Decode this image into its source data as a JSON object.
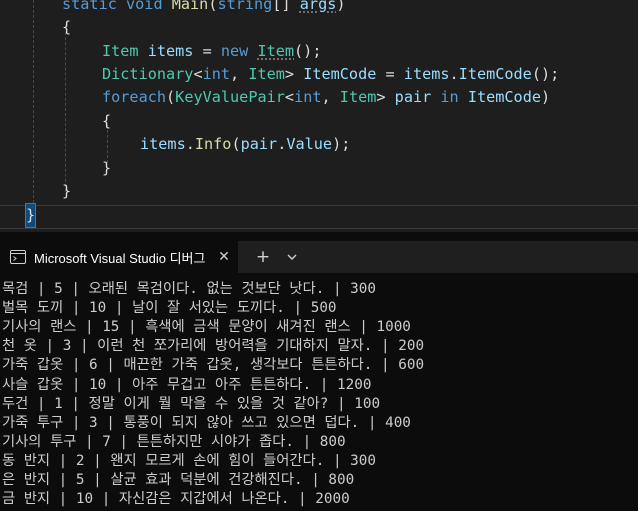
{
  "editor": {
    "lines": [
      {
        "parts": [
          {
            "c": "k",
            "t": "static "
          },
          {
            "c": "k",
            "t": "void "
          },
          {
            "c": "m",
            "t": "Main"
          },
          {
            "c": "p",
            "t": "("
          },
          {
            "c": "k",
            "t": "string"
          },
          {
            "c": "p",
            "t": "[] "
          },
          {
            "c": "v",
            "t": "args"
          },
          {
            "c": "p",
            "t": ")"
          }
        ]
      },
      {
        "parts": [
          {
            "c": "p",
            "t": "{"
          }
        ]
      },
      {
        "parts": [
          {
            "c": "t",
            "t": "Item "
          },
          {
            "c": "v",
            "t": "items"
          },
          {
            "c": "p",
            "t": " = "
          },
          {
            "c": "k",
            "t": "new "
          },
          {
            "c": "t",
            "t": "Item"
          },
          {
            "c": "p",
            "t": "();"
          }
        ]
      },
      {
        "parts": [
          {
            "c": "t",
            "t": "Dictionary"
          },
          {
            "c": "p",
            "t": "<"
          },
          {
            "c": "k",
            "t": "int"
          },
          {
            "c": "p",
            "t": ", "
          },
          {
            "c": "t",
            "t": "Item"
          },
          {
            "c": "p",
            "t": "> "
          },
          {
            "c": "v",
            "t": "ItemCode"
          },
          {
            "c": "p",
            "t": " = "
          },
          {
            "c": "v",
            "t": "items"
          },
          {
            "c": "p",
            "t": "."
          },
          {
            "c": "v",
            "t": "ItemCode"
          },
          {
            "c": "p",
            "t": "();"
          }
        ]
      },
      {
        "parts": [
          {
            "c": "k",
            "t": "foreach"
          },
          {
            "c": "p",
            "t": "("
          },
          {
            "c": "t",
            "t": "KeyValuePair"
          },
          {
            "c": "p",
            "t": "<"
          },
          {
            "c": "k",
            "t": "int"
          },
          {
            "c": "p",
            "t": ", "
          },
          {
            "c": "t",
            "t": "Item"
          },
          {
            "c": "p",
            "t": "> "
          },
          {
            "c": "v",
            "t": "pair"
          },
          {
            "c": "k",
            "t": " in "
          },
          {
            "c": "v",
            "t": "ItemCode"
          },
          {
            "c": "p",
            "t": ")"
          }
        ]
      },
      {
        "parts": [
          {
            "c": "p",
            "t": "{"
          }
        ]
      },
      {
        "parts": [
          {
            "c": "v",
            "t": "items"
          },
          {
            "c": "p",
            "t": "."
          },
          {
            "c": "m",
            "t": "Info"
          },
          {
            "c": "p",
            "t": "("
          },
          {
            "c": "v",
            "t": "pair"
          },
          {
            "c": "p",
            "t": "."
          },
          {
            "c": "v",
            "t": "Value"
          },
          {
            "c": "p",
            "t": ");"
          }
        ]
      },
      {
        "parts": [
          {
            "c": "p",
            "t": "}"
          }
        ]
      },
      {
        "parts": [
          {
            "c": "p",
            "t": "}"
          }
        ]
      },
      {
        "parts": [
          {
            "c": "p",
            "t": "}"
          }
        ]
      }
    ]
  },
  "terminal": {
    "tab_title": "Microsoft Visual Studio 디버그",
    "close_glyph": "✕",
    "add_glyph": "+",
    "output": [
      "목검 | 5 | 오래된 목검이다. 없는 것보단 낫다. | 300",
      "벌목 도끼 | 10 | 날이 잘 서있는 도끼다. | 500",
      "기사의 랜스 | 15 | 흑색에 금색 문양이 새겨진 랜스 | 1000",
      "천 옷 | 3 | 이런 천 쪼가리에 방어력을 기대하지 말자. | 200",
      "가죽 갑옷 | 6 | 매끈한 가죽 갑옷, 생각보다 튼튼하다. | 600",
      "사슬 갑옷 | 10 | 아주 무겁고 아주 튼튼하다. | 1200",
      "두건 | 1 | 정말 이게 뭘 막을 수 있을 것 같아? | 100",
      "가죽 투구 | 3 | 통풍이 되지 않아 쓰고 있으면 덥다. | 400",
      "기사의 투구 | 7 | 튼튼하지만 시야가 좁다. | 800",
      "동 반지 | 2 | 왠지 모르게 손에 힘이 들어간다. | 300",
      "은 반지 | 5 | 살균 효과 덕분에 건강해진다. | 800",
      "금 반지 | 10 | 자신감은 지갑에서 나온다. | 2000"
    ]
  }
}
